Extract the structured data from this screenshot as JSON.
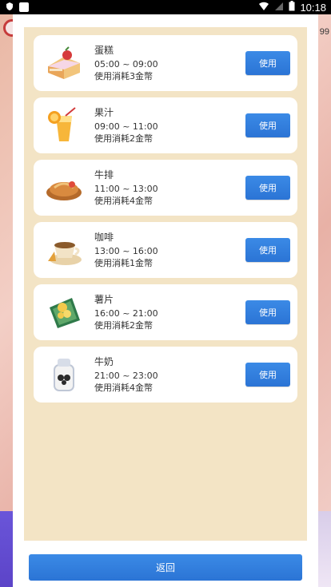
{
  "status_bar": {
    "time": "10:18",
    "icons": [
      "shield-icon",
      "app-icon",
      "wifi-icon",
      "signal-icon",
      "battery-icon"
    ]
  },
  "background": {
    "right_text": "99"
  },
  "items": [
    {
      "name": "蛋糕",
      "time": "05:00 ~ 09:00",
      "cost": "使用消耗3金幣",
      "button": "使用",
      "icon": "cake-icon"
    },
    {
      "name": "果汁",
      "time": "09:00 ~ 11:00",
      "cost": "使用消耗2金幣",
      "button": "使用",
      "icon": "juice-icon"
    },
    {
      "name": "牛排",
      "time": "11:00 ~ 13:00",
      "cost": "使用消耗4金幣",
      "button": "使用",
      "icon": "steak-icon"
    },
    {
      "name": "咖啡",
      "time": "13:00 ~ 16:00",
      "cost": "使用消耗1金幣",
      "button": "使用",
      "icon": "coffee-icon"
    },
    {
      "name": "薯片",
      "time": "16:00 ~ 21:00",
      "cost": "使用消耗2金幣",
      "button": "使用",
      "icon": "chips-icon"
    },
    {
      "name": "牛奶",
      "time": "21:00 ~ 23:00",
      "cost": "使用消耗4金幣",
      "button": "使用",
      "icon": "milk-icon"
    }
  ],
  "footer": {
    "back_label": "返回"
  }
}
